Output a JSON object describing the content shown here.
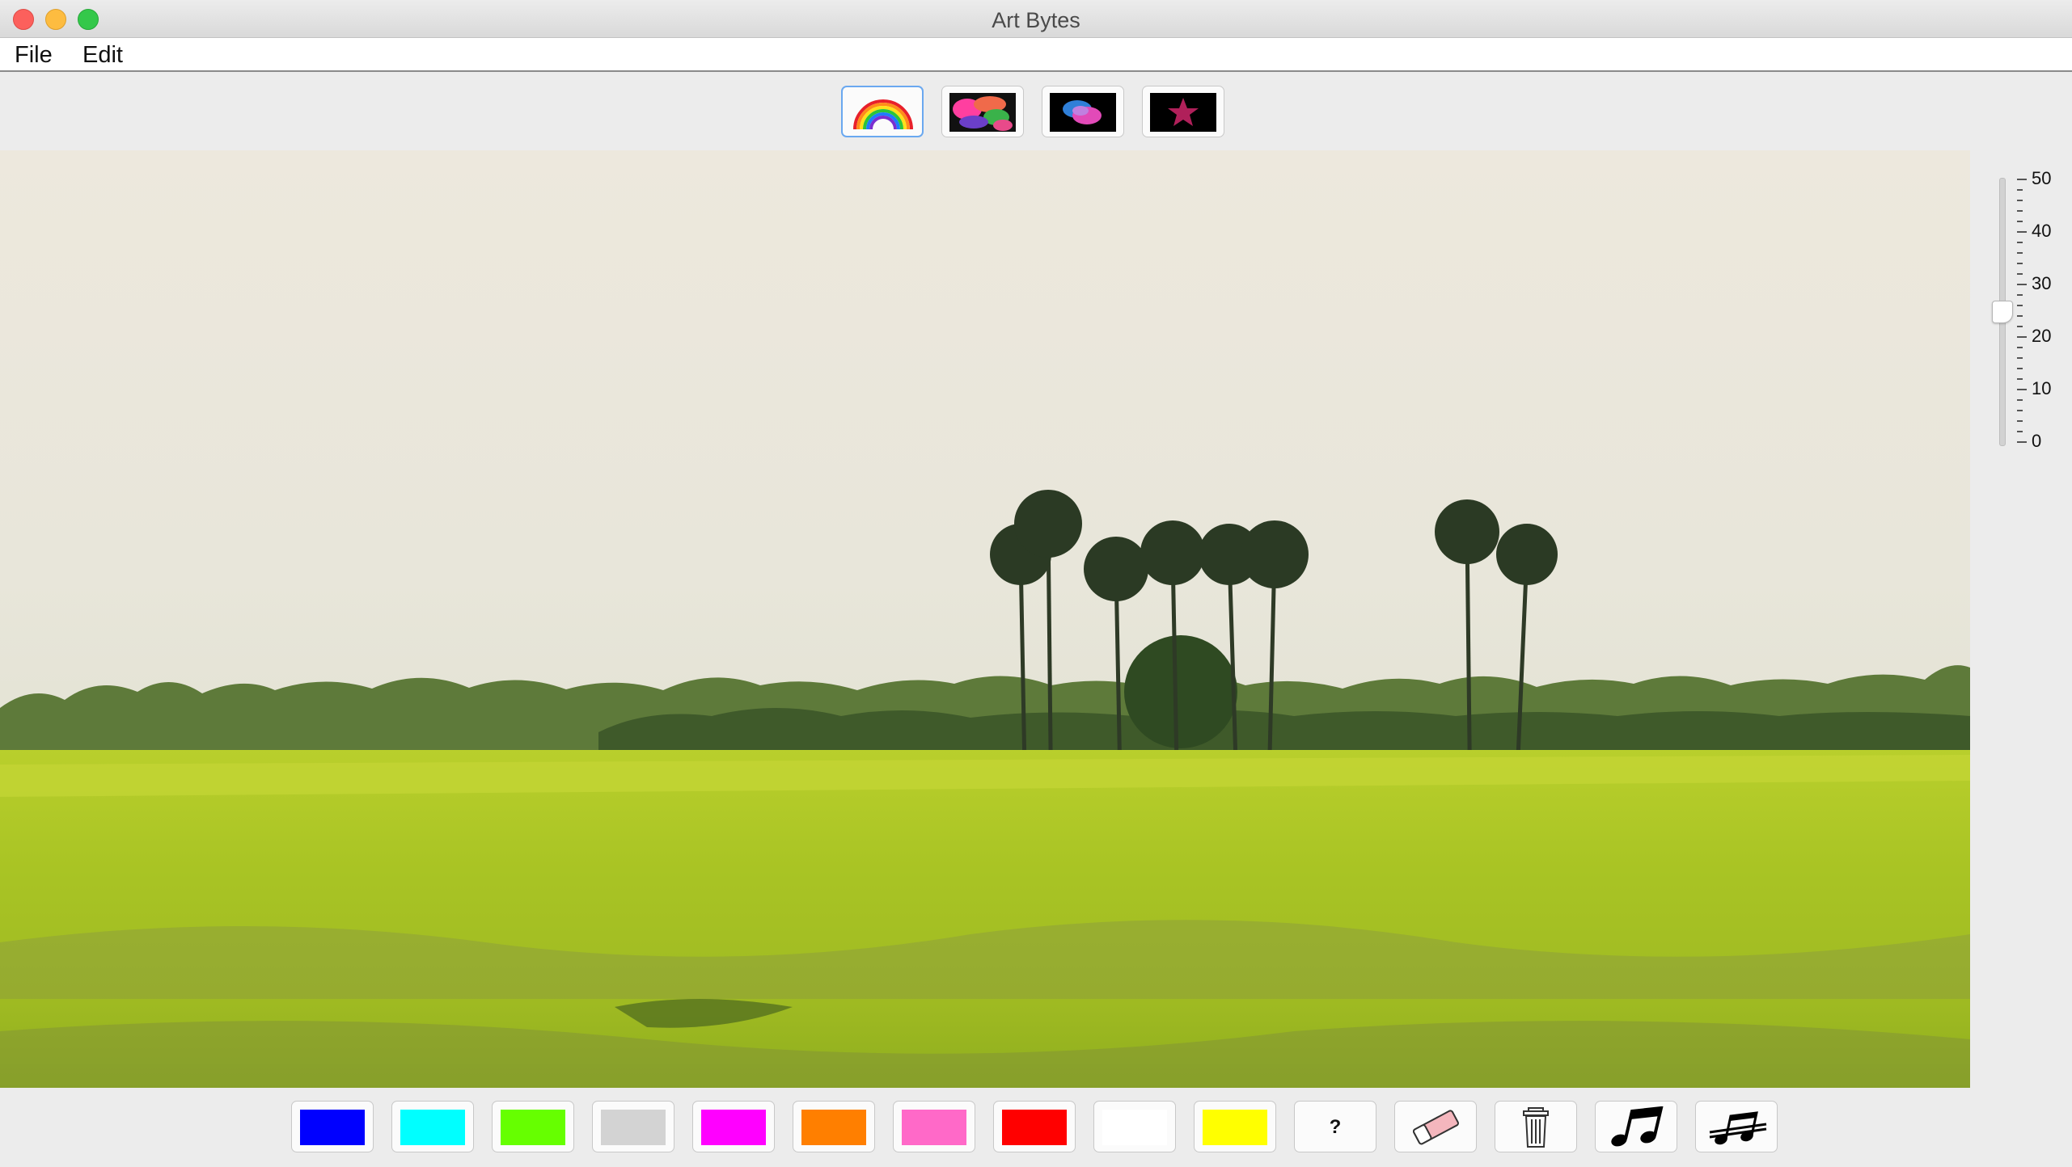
{
  "window": {
    "title": "Art Bytes"
  },
  "menu": {
    "file": "File",
    "edit": "Edit"
  },
  "toolbar": {
    "tools": [
      {
        "icon": "rainbow-icon",
        "selected": true
      },
      {
        "icon": "color-blobs-icon",
        "selected": false
      },
      {
        "icon": "overlapping-circles-icon",
        "selected": false
      },
      {
        "icon": "star-icon",
        "selected": false
      }
    ]
  },
  "canvas": {
    "content": "landscape-photo-rice-field-palm-trees"
  },
  "slider": {
    "labels": [
      "50",
      "40",
      "30",
      "20",
      "10",
      "0"
    ],
    "min": 0,
    "max": 50,
    "value": 25
  },
  "palette": {
    "colors": [
      "#0000ff",
      "#00ffff",
      "#66ff00",
      "#d3d3d3",
      "#ff00ff",
      "#ff7f00",
      "#ff69c8",
      "#ff0000",
      "#ffffff",
      "#ffff00"
    ],
    "help_label": "?",
    "tools": [
      "eraser-icon",
      "trash-icon",
      "music-note-icon",
      "music-mute-icon"
    ]
  }
}
